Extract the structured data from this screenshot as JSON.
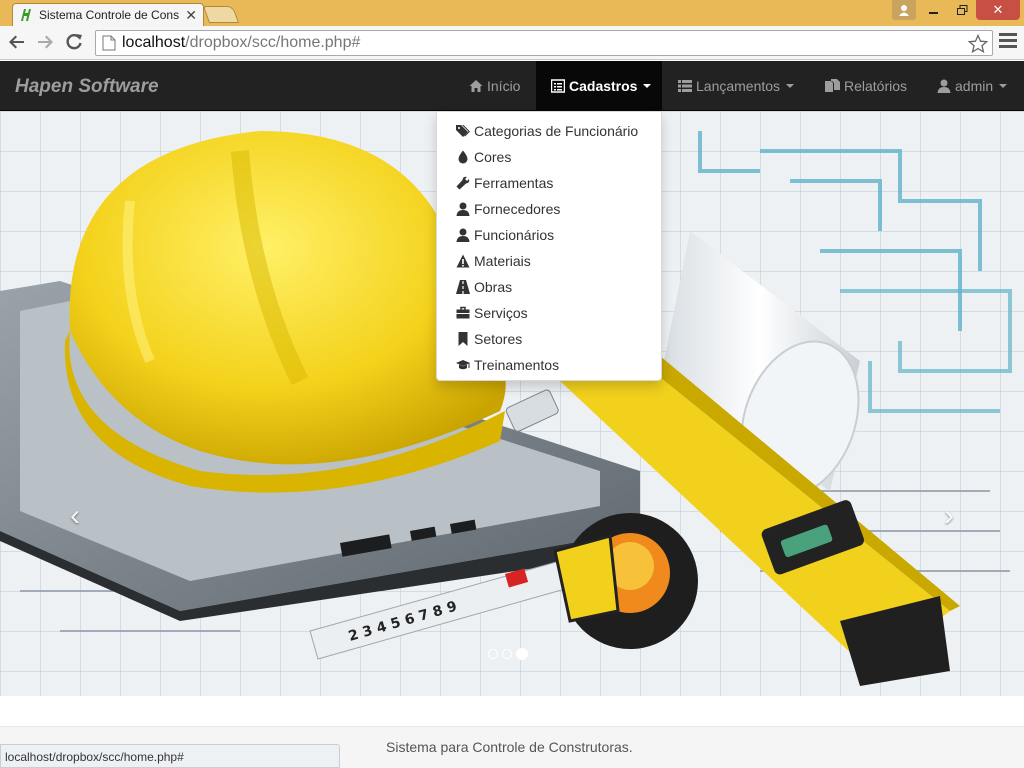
{
  "browser": {
    "tab_title": "Sistema Controle de Cons",
    "url_host": "localhost",
    "url_path": "/dropbox/scc/home.php#",
    "status_url": "localhost/dropbox/scc/home.php#"
  },
  "navbar": {
    "brand": "Hapen Software",
    "items": [
      {
        "label": "Início",
        "icon": "home-icon"
      },
      {
        "label": "Cadastros",
        "icon": "list-alt-icon",
        "active": true
      },
      {
        "label": "Lançamentos",
        "icon": "list-icon"
      },
      {
        "label": "Relatórios",
        "icon": "duplicate-icon"
      },
      {
        "label": "admin",
        "icon": "user-icon"
      }
    ]
  },
  "dropdown": {
    "items": [
      {
        "label": "Categorias de Funcionário",
        "icon": "tags-icon"
      },
      {
        "label": "Cores",
        "icon": "tint-icon"
      },
      {
        "label": "Ferramentas",
        "icon": "wrench-icon"
      },
      {
        "label": "Fornecedores",
        "icon": "user-icon"
      },
      {
        "label": "Funcionários",
        "icon": "user-icon"
      },
      {
        "label": "Materiais",
        "icon": "warning-icon"
      },
      {
        "label": "Obras",
        "icon": "road-icon"
      },
      {
        "label": "Serviços",
        "icon": "briefcase-icon"
      },
      {
        "label": "Setores",
        "icon": "bookmark-icon"
      },
      {
        "label": "Treinamentos",
        "icon": "education-icon"
      }
    ]
  },
  "carousel": {
    "slide_count": 3,
    "active_index": 2
  },
  "footer": {
    "text": "Sistema para Controle de Construtoras."
  },
  "colors": {
    "navbar_bg": "#222222",
    "titlebar": "#e8b956",
    "helmet": "#f4d21c"
  }
}
